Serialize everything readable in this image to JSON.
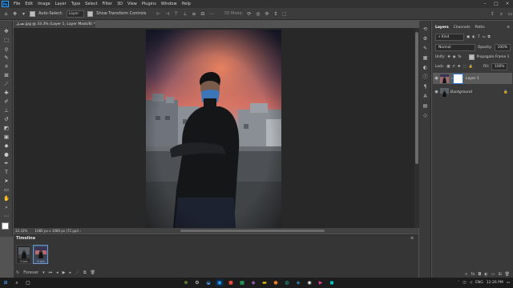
{
  "app": {
    "logo": "Ps"
  },
  "menu": [
    "File",
    "Edit",
    "Image",
    "Layer",
    "Type",
    "Select",
    "Filter",
    "3D",
    "View",
    "Plugins",
    "Window",
    "Help"
  ],
  "options": {
    "auto_select_label": "Auto-Select:",
    "auto_select_value": "Layer",
    "transform_label": "Show Transform Controls",
    "mode_label": "3D Mode:"
  },
  "document": {
    "tab_title": "تعديل.jpg @ 33.3% (Layer 1, Layer Mask/8) *",
    "tab_close": "×",
    "zoom": "33.33%",
    "size_info": "1080 px x 1080 px (72 ppi)"
  },
  "timeline": {
    "title": "Timeline",
    "frames": [
      {
        "number": "1",
        "duration": "0 sec."
      },
      {
        "number": "2",
        "duration": "0 sec."
      }
    ],
    "loop": "Forever"
  },
  "layers_panel": {
    "tabs": [
      "Layers",
      "Channels",
      "Paths"
    ],
    "kind": "Kind",
    "blend_mode": "Normal",
    "opacity_label": "Opacity:",
    "opacity_value": "100%",
    "unify_label": "Unify:",
    "propagate_label": "Propagate Frame 1",
    "lock_label": "Lock:",
    "fill_label": "Fill:",
    "fill_value": "100%",
    "layers": [
      {
        "name": "Layer 1",
        "selected": true
      },
      {
        "name": "Background",
        "selected": false
      }
    ]
  },
  "taskbar": {
    "lang": "ENG",
    "time": "12:26 PM"
  },
  "colors": {
    "accent": "#31a8ff",
    "selected_layer": "#5a5a5a",
    "mask_blue": "#2a6fd6"
  },
  "icons": [
    "move-icon",
    "marquee-icon",
    "lasso-icon",
    "quick-select-icon",
    "crop-icon",
    "frame-icon",
    "eyedropper-icon",
    "healing-icon",
    "brush-icon",
    "stamp-icon",
    "history-brush-icon",
    "eraser-icon",
    "gradient-icon",
    "blur-icon",
    "dodge-icon",
    "pen-icon",
    "type-icon",
    "path-select-icon",
    "rectangle-icon",
    "hand-icon",
    "zoom-icon",
    "more-icon",
    "color-swatch-icon",
    "quick-mask-icon",
    "screen-mode-icon"
  ]
}
